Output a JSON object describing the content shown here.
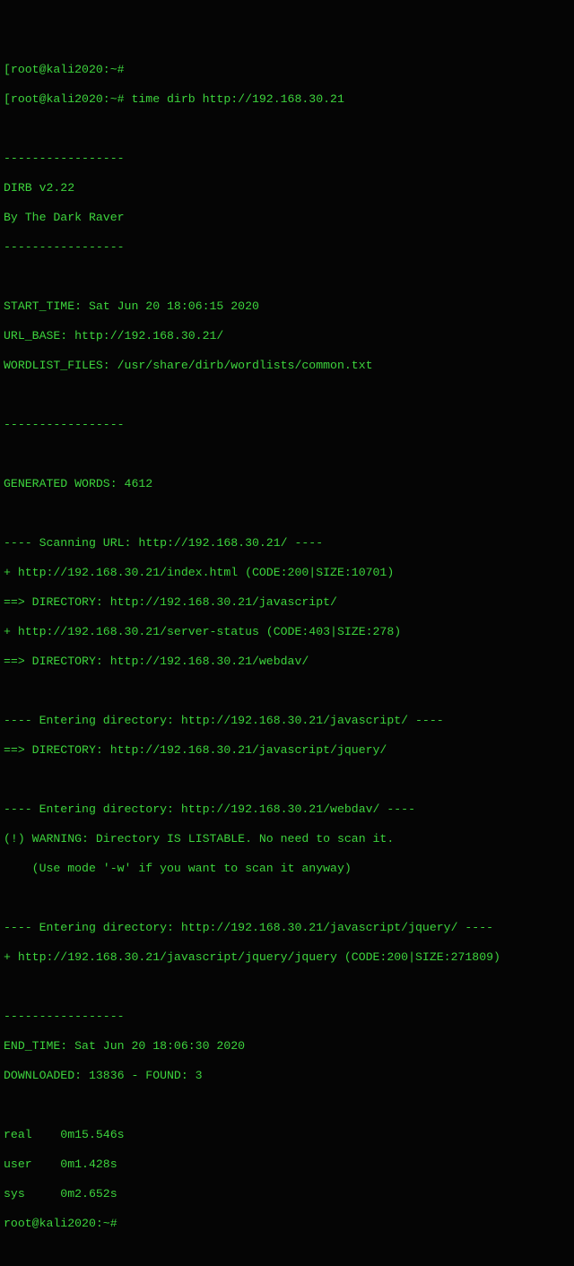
{
  "prompt1": "[root@kali2020:~#",
  "command_line": "[root@kali2020:~# time dirb http://192.168.30.21",
  "sep": "-----------------",
  "banner1": "DIRB v2.22",
  "banner2": "By The Dark Raver",
  "start_time": "START_TIME: Sat Jun 20 18:06:15 2020",
  "url_base": "URL_BASE: http://192.168.30.21/",
  "wordlist": "WORDLIST_FILES: /usr/share/dirb/wordlists/common.txt",
  "gen_words": "GENERATED WORDS: 4612",
  "scan_url": "---- Scanning URL: http://192.168.30.21/ ----",
  "hit_index": "+ http://192.168.30.21/index.html (CODE:200|SIZE:10701)",
  "dir_js": "==> DIRECTORY: http://192.168.30.21/javascript/",
  "hit_status": "+ http://192.168.30.21/server-status (CODE:403|SIZE:278)",
  "dir_webdav": "==> DIRECTORY: http://192.168.30.21/webdav/",
  "enter_js": "---- Entering directory: http://192.168.30.21/javascript/ ----",
  "dir_jquery": "==> DIRECTORY: http://192.168.30.21/javascript/jquery/",
  "enter_webdav": "---- Entering directory: http://192.168.30.21/webdav/ ----",
  "warn1": "(!) WARNING: Directory IS LISTABLE. No need to scan it.",
  "warn2": "    (Use mode '-w' if you want to scan it anyway)",
  "enter_jquery": "---- Entering directory: http://192.168.30.21/javascript/jquery/ ----",
  "hit_jquery": "+ http://192.168.30.21/javascript/jquery/jquery (CODE:200|SIZE:271809)",
  "end_time": "END_TIME: Sat Jun 20 18:06:30 2020",
  "downloaded": "DOWNLOADED: 13836 - FOUND: 3",
  "time_real": "real    0m15.546s",
  "time_user": "user    0m1.428s",
  "time_sys": "sys     0m2.652s",
  "prompt2": "root@kali2020:~#"
}
